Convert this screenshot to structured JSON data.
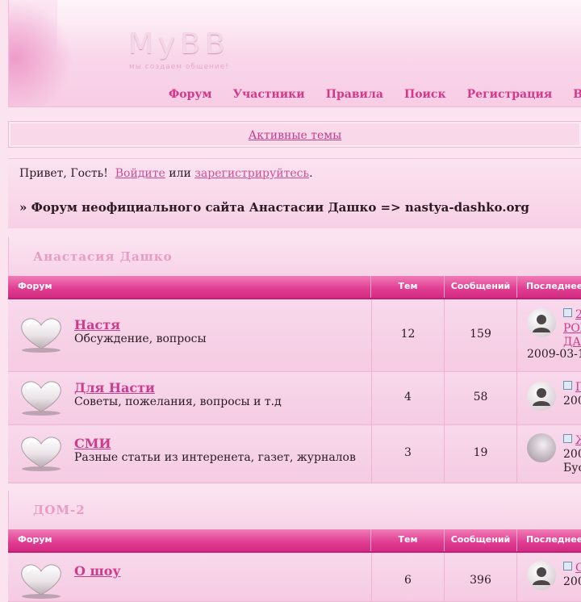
{
  "header": {
    "logo": "MyBB",
    "slogan": "мы создаем общение!",
    "nav": [
      "Форум",
      "Участники",
      "Правила",
      "Поиск",
      "Регистрация",
      "Войти"
    ]
  },
  "active_topics": "Активные темы",
  "welcome": {
    "greeting": "Привет, Гость!",
    "login": "Войдите",
    "or": "или",
    "register": "зарегистрируйтесь",
    "period": "."
  },
  "breadcrumb": "» Форум неофициального сайта Анастасии Дашко => nastya-dashko.org",
  "columns": {
    "forum": "Форум",
    "topics": "Тем",
    "posts": "Сообщений",
    "last": "Последнее сообщение"
  },
  "categories": [
    {
      "title": "Анастасия Дашко",
      "forums": [
        {
          "name": "Настя",
          "desc": "Обсуждение, вопросы",
          "topics": "12",
          "posts": "159",
          "last_line1": "2",
          "last_line2": "РОЖ",
          "last_line3": "ДА",
          "last_date": "2009-03-1"
        },
        {
          "name": "Для Насти",
          "desc": "Советы, пожелания, вопросы и т.д",
          "topics": "4",
          "posts": "58",
          "last_line1": "П",
          "last_date": "200"
        },
        {
          "name": "СМИ",
          "desc": "Разные статьи из интеренета, газет, журналов",
          "topics": "3",
          "posts": "19",
          "last_line1": "Ж",
          "last_date": "200",
          "last_author": "Буо"
        }
      ]
    },
    {
      "title": "ДОМ-2",
      "forums": [
        {
          "name": "О шоу",
          "topics": "6",
          "posts": "396",
          "last_line1": "С",
          "last_date": "200"
        }
      ]
    }
  ],
  "colors": {
    "accent": "#d6378a",
    "header_bar": "#e03c91",
    "background": "#fbe3f0"
  }
}
